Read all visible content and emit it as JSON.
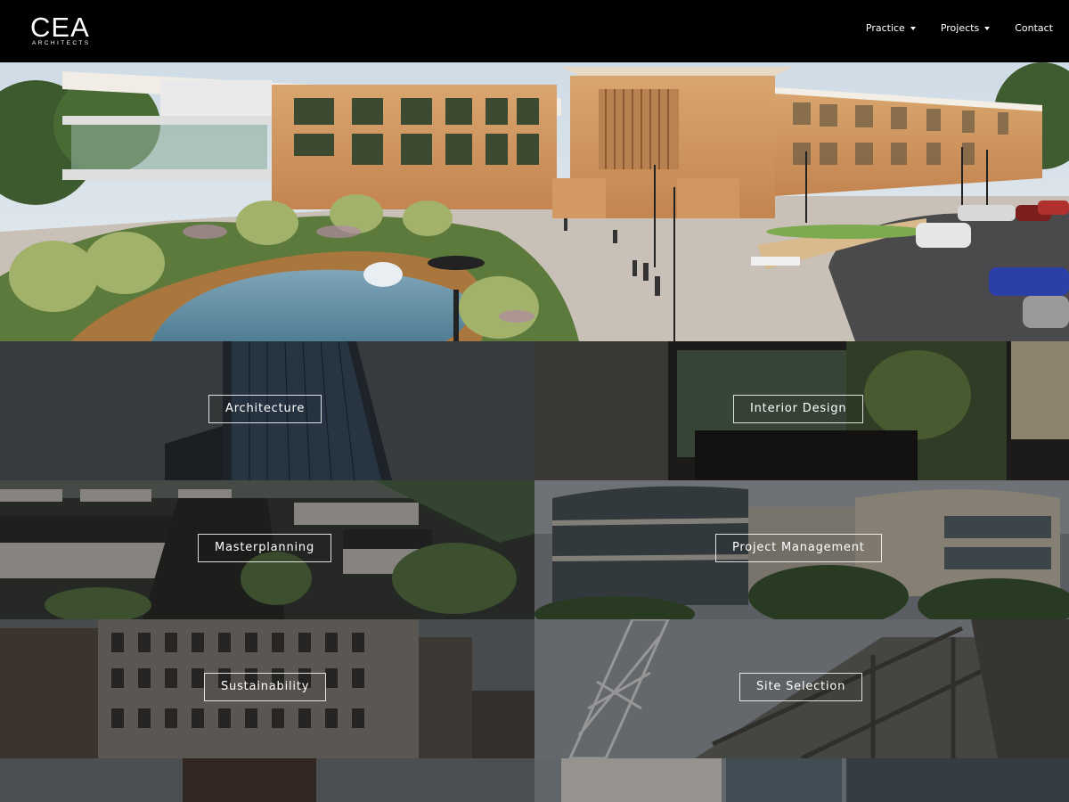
{
  "header": {
    "logo_main": "CEA",
    "logo_sub": "ARCHITECTS",
    "nav": [
      {
        "label": "Practice",
        "has_dropdown": true
      },
      {
        "label": "Projects",
        "has_dropdown": true
      },
      {
        "label": "Contact",
        "has_dropdown": false
      }
    ]
  },
  "tiles": [
    {
      "label": "Architecture"
    },
    {
      "label": "Interior Design"
    },
    {
      "label": "Masterplanning"
    },
    {
      "label": "Project Management"
    },
    {
      "label": "Sustainability"
    },
    {
      "label": "Site Selection"
    }
  ],
  "colors": {
    "header_bg": "#000000",
    "text": "#ffffff",
    "tile_border": "#ffffff"
  }
}
